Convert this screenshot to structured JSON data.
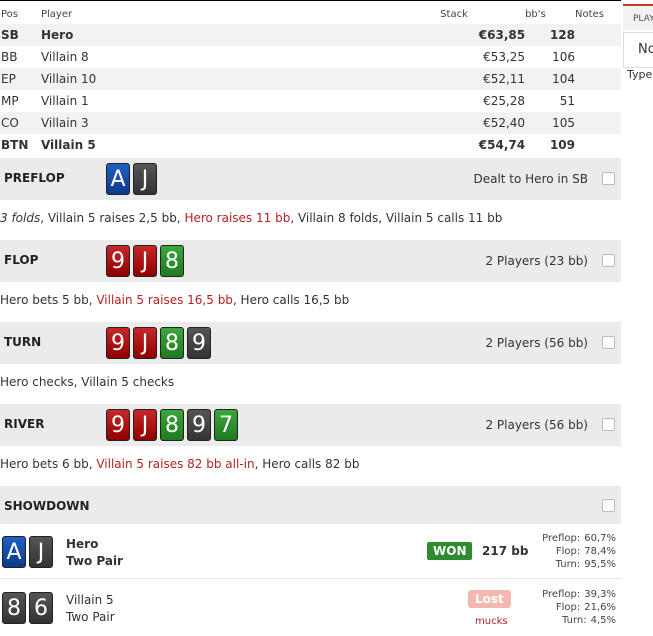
{
  "header": {
    "pos": "Pos",
    "player": "Player",
    "stack": "Stack",
    "bbs": "bb's",
    "notes": "Notes"
  },
  "players": [
    {
      "pos": "SB",
      "name": "Hero",
      "stack": "€63,85",
      "bb": "128",
      "bold": true
    },
    {
      "pos": "BB",
      "name": "Villain 8",
      "stack": "€53,25",
      "bb": "106",
      "bold": false
    },
    {
      "pos": "EP",
      "name": "Villain 10",
      "stack": "€52,11",
      "bb": "104",
      "bold": false
    },
    {
      "pos": "MP",
      "name": "Villain 1",
      "stack": "€25,28",
      "bb": "51",
      "bold": false
    },
    {
      "pos": "CO",
      "name": "Villain 3",
      "stack": "€52,40",
      "bb": "105",
      "bold": false
    },
    {
      "pos": "BTN",
      "name": "Villain 5",
      "stack": "€54,74",
      "bb": "109",
      "bold": true
    }
  ],
  "streets": {
    "preflop": {
      "name": "PREFLOP",
      "info": "Dealt to Hero in SB",
      "cards": [
        {
          "rank": "A",
          "suit": "d"
        },
        {
          "rank": "J",
          "suit": "s"
        }
      ],
      "action": [
        {
          "t": "3 folds",
          "italic": true
        },
        {
          "t": ", Villain 5 raises 2,5 bb, "
        },
        {
          "t": "Hero raises 11 bb",
          "raise": true
        },
        {
          "t": ", Villain 8 folds, Villain 5 calls 11 bb"
        }
      ]
    },
    "flop": {
      "name": "FLOP",
      "info": "2 Players (23 bb)",
      "cards": [
        {
          "rank": "9",
          "suit": "h"
        },
        {
          "rank": "J",
          "suit": "h"
        },
        {
          "rank": "8",
          "suit": "c"
        }
      ],
      "action": [
        {
          "t": "Hero bets 5 bb, "
        },
        {
          "t": "Villain 5 raises 16,5 bb",
          "raise": true
        },
        {
          "t": ", Hero calls 16,5 bb"
        }
      ]
    },
    "turn": {
      "name": "TURN",
      "info": "2 Players (56 bb)",
      "cards": [
        {
          "rank": "9",
          "suit": "h"
        },
        {
          "rank": "J",
          "suit": "h"
        },
        {
          "rank": "8",
          "suit": "c"
        },
        {
          "rank": "9",
          "suit": "s"
        }
      ],
      "action": [
        {
          "t": "Hero checks, Villain 5 checks"
        }
      ]
    },
    "river": {
      "name": "RIVER",
      "info": "2 Players (56 bb)",
      "cards": [
        {
          "rank": "9",
          "suit": "h"
        },
        {
          "rank": "J",
          "suit": "h"
        },
        {
          "rank": "8",
          "suit": "c"
        },
        {
          "rank": "9",
          "suit": "s"
        },
        {
          "rank": "7",
          "suit": "c"
        }
      ],
      "action": [
        {
          "t": "Hero bets 6 bb, "
        },
        {
          "t": "Villain 5 raises 82 bb all-in",
          "raise": true
        },
        {
          "t": ", Hero calls 82 bb"
        }
      ]
    }
  },
  "showdown": {
    "title": "SHOWDOWN",
    "hero": {
      "name": "Hero",
      "hand": "Two Pair",
      "result": "WON",
      "amount": "217 bb",
      "cards": [
        {
          "rank": "A",
          "suit": "d"
        },
        {
          "rank": "J",
          "suit": "s"
        }
      ],
      "equity": [
        {
          "l": "Preflop:",
          "v": "60,7%"
        },
        {
          "l": "Flop:",
          "v": "78,4%"
        },
        {
          "l": "Turn:",
          "v": "95,5%"
        }
      ]
    },
    "villain": {
      "name": "Villain 5",
      "hand": "Two Pair",
      "result": "Lost",
      "mucks": "mucks",
      "cards": [
        {
          "rank": "8",
          "suit": "s"
        },
        {
          "rank": "6",
          "suit": "s"
        }
      ],
      "equity": [
        {
          "l": "Preflop:",
          "v": "39,3%"
        },
        {
          "l": "Flop:",
          "v": "21,6%"
        },
        {
          "l": "Turn:",
          "v": "4,5%"
        }
      ]
    }
  },
  "side": {
    "tab": "PLAYERS",
    "no": "No",
    "type": "Type"
  }
}
